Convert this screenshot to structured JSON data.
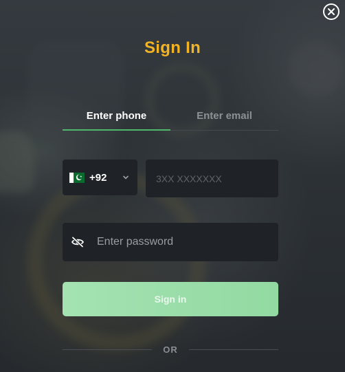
{
  "modal": {
    "title": "Sign In",
    "close_icon": "close-circle-icon"
  },
  "tabs": [
    {
      "label": "Enter phone",
      "active": true
    },
    {
      "label": "Enter email",
      "active": false
    }
  ],
  "phone": {
    "country_flag": "pakistan-flag-icon",
    "dial_code": "+92",
    "placeholder": "3XX XXXXXXX",
    "value": ""
  },
  "password": {
    "placeholder": "Enter password",
    "value": "",
    "toggle_icon": "eye-off-icon"
  },
  "submit": {
    "label": "Sign in"
  },
  "divider": {
    "label": "OR"
  },
  "colors": {
    "title": "#f2b324",
    "active_tab_underline": "#4fb86a",
    "button_bg": "#a4e2b2",
    "input_bg": "#1f2226"
  }
}
